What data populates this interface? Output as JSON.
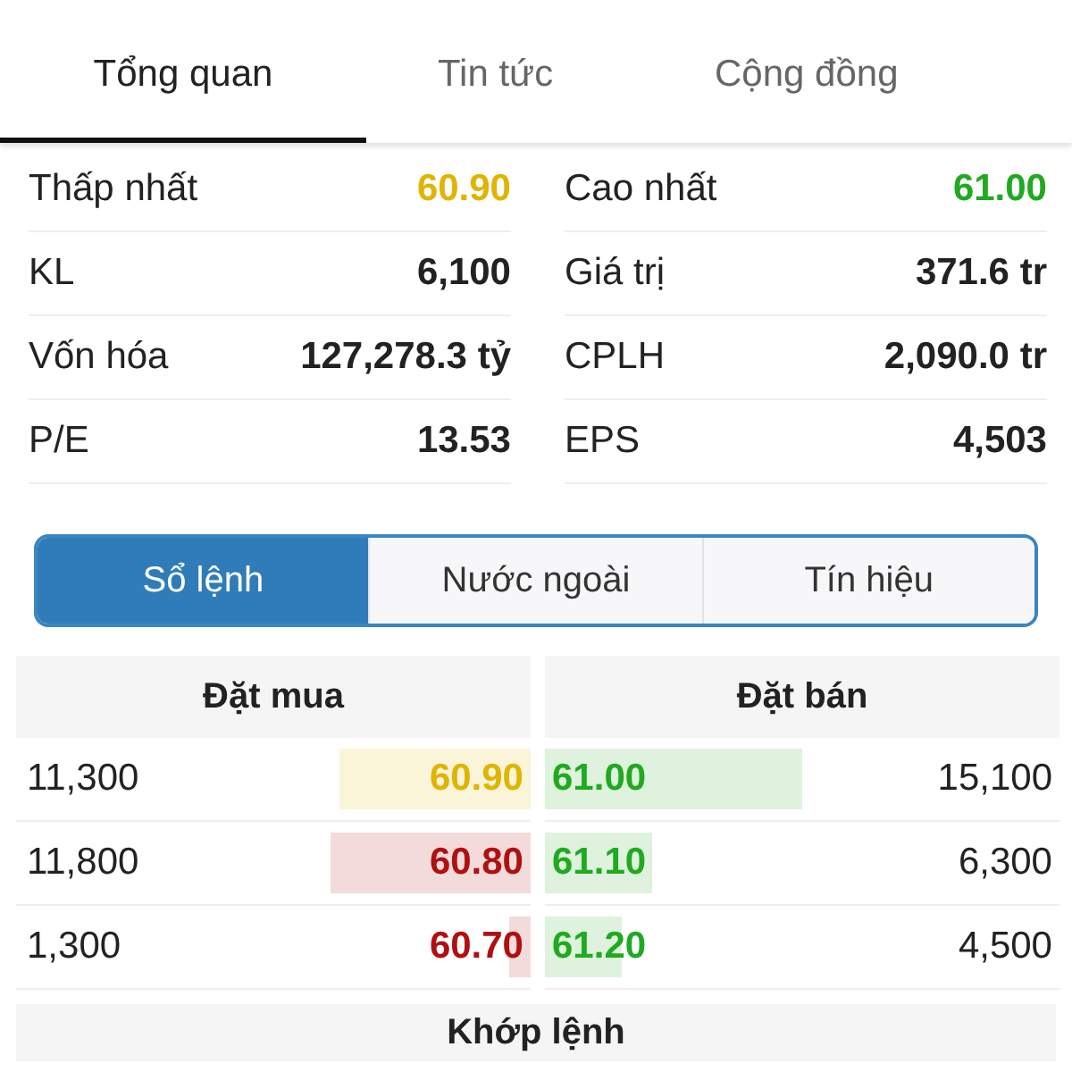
{
  "tabs": [
    {
      "label": "Tổng quan",
      "selected": true
    },
    {
      "label": "Tin tức",
      "selected": false
    },
    {
      "label": "Cộng đồng",
      "selected": false
    }
  ],
  "stats": [
    {
      "label": "Thấp nhất",
      "value": "60.90",
      "color": "#e0b400"
    },
    {
      "label": "Cao nhất",
      "value": "61.00",
      "color": "#1faa1f"
    },
    {
      "label": "KL",
      "value": "6,100",
      "color": "#222222"
    },
    {
      "label": "Giá trị",
      "value": "371.6 tr",
      "color": "#222222"
    },
    {
      "label": "Vốn hóa",
      "value": "127,278.3 tỷ",
      "color": "#222222"
    },
    {
      "label": "CPLH",
      "value": "2,090.0 tr",
      "color": "#222222"
    },
    {
      "label": "P/E",
      "value": "13.53",
      "color": "#222222"
    },
    {
      "label": "EPS",
      "value": "4,503",
      "color": "#222222"
    }
  ],
  "segments": [
    {
      "label": "Sổ lệnh",
      "selected": true
    },
    {
      "label": "Nước ngoài",
      "selected": false
    },
    {
      "label": "Tín hiệu",
      "selected": false
    }
  ],
  "order_book": {
    "buy_header": "Đặt mua",
    "sell_header": "Đặt bán",
    "buy": [
      {
        "volume": "11,300",
        "price": "60.90",
        "color": "#e0b400",
        "level": 0.37
      },
      {
        "volume": "11,800",
        "price": "60.80",
        "color": "#b01010",
        "level": 0.39
      },
      {
        "volume": "1,300",
        "price": "60.70",
        "color": "#b01010",
        "level": 0.04
      }
    ],
    "sell": [
      {
        "price": "61.00",
        "color": "#1faa1f",
        "level": 0.5,
        "volume": "15,100"
      },
      {
        "price": "61.10",
        "color": "#1faa1f",
        "level": 0.21,
        "volume": "6,300"
      },
      {
        "price": "61.20",
        "color": "#1faa1f",
        "level": 0.15,
        "volume": "4,500"
      }
    ]
  },
  "matched_header": "Khớp lệnh"
}
